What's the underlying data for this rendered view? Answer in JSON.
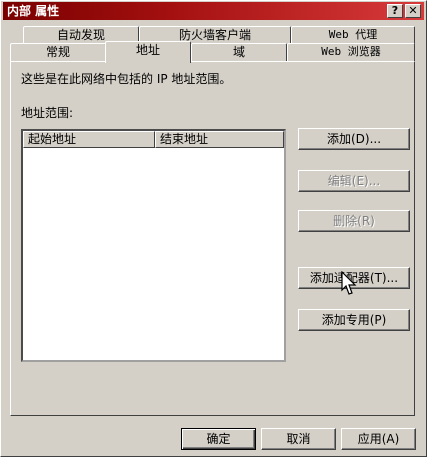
{
  "window": {
    "title": "内部 属性",
    "help_label": "?",
    "close_label": "✕"
  },
  "tabs_back": [
    {
      "label": "自动发现"
    },
    {
      "label": "防火墙客户端"
    },
    {
      "label": "Web 代理"
    }
  ],
  "tabs_front": [
    {
      "label": "常规"
    },
    {
      "label": "地址",
      "active": true
    },
    {
      "label": "域"
    },
    {
      "label": "Web 浏览器"
    }
  ],
  "panel": {
    "description": "这些是在此网络中包括的 IP 地址范围。",
    "range_label": "地址范围:",
    "columns": [
      "起始地址",
      "结束地址"
    ],
    "rows": []
  },
  "side_buttons": {
    "add": "添加(D)...",
    "edit": "编辑(E)...",
    "delete": "删除(R)",
    "add_adapter": "添加适配器(T)...",
    "add_private": "添加专用(P)"
  },
  "footer": {
    "ok": "确定",
    "cancel": "取消",
    "apply": "应用(A)"
  }
}
